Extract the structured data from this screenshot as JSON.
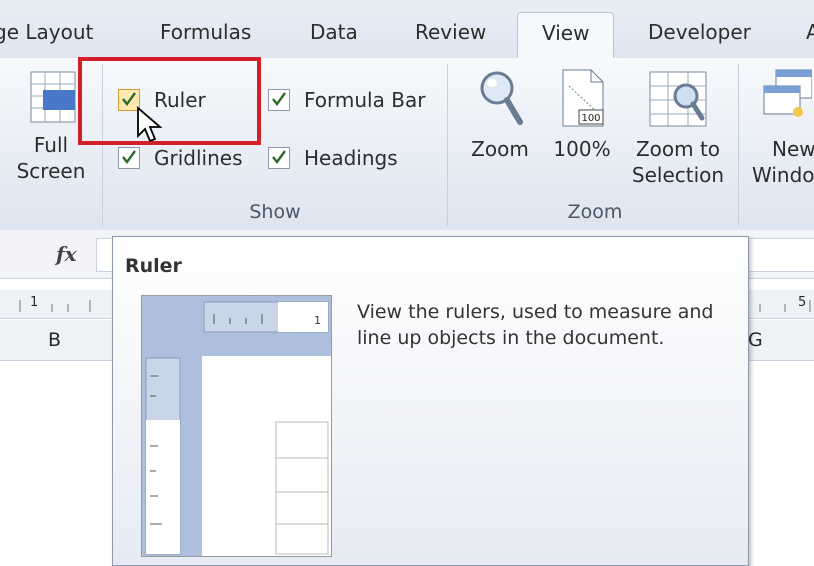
{
  "tabs": [
    {
      "label": "ge Layout",
      "active": false
    },
    {
      "label": "Formulas",
      "active": false
    },
    {
      "label": "Data",
      "active": false
    },
    {
      "label": "Review",
      "active": false
    },
    {
      "label": "View",
      "active": true
    },
    {
      "label": "Developer",
      "active": false
    },
    {
      "label": "A",
      "active": false
    }
  ],
  "ribbon": {
    "full_screen": {
      "line1": "Full",
      "line2": "Screen",
      "icon": "full-screen-icon"
    },
    "show": {
      "label": "Show",
      "items": [
        {
          "label": "Ruler",
          "checked": true
        },
        {
          "label": "Formula Bar",
          "checked": true
        },
        {
          "label": "Gridlines",
          "checked": true
        },
        {
          "label": "Headings",
          "checked": true
        }
      ]
    },
    "zoom": {
      "label": "Zoom",
      "zoom_btn": "Zoom",
      "hundred_btn": "100%",
      "hundred_icon_text": "100",
      "zoom_sel_line1": "Zoom to",
      "zoom_sel_line2": "Selection"
    },
    "new_window": {
      "line1": "New",
      "line2": "Windo"
    }
  },
  "formula_bar": {
    "fx": "fx"
  },
  "ruler": {
    "left_num": "1",
    "right_num": "5",
    "preview_num": "1"
  },
  "columns": {
    "left": "B",
    "right": "G"
  },
  "tooltip": {
    "title": "Ruler",
    "description": "View the rulers, used to measure and line up objects in the document."
  },
  "colors": {
    "highlight": "#d21f28",
    "ribbon_bg": "#e3eaf3",
    "tooltip_border": "#8e9aab"
  }
}
